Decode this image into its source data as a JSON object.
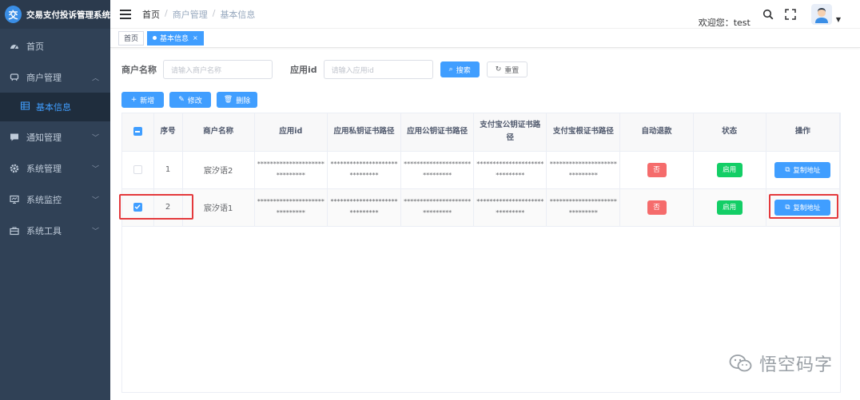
{
  "app": {
    "title": "交易支付投诉管理系统",
    "logo_char": "交"
  },
  "sidebar": {
    "items": [
      {
        "label": "首页",
        "icon": "dashboard-icon"
      },
      {
        "label": "商户管理",
        "icon": "shop-icon",
        "expanded": true
      },
      {
        "label": "通知管理",
        "icon": "message-icon"
      },
      {
        "label": "系统管理",
        "icon": "gear-icon"
      },
      {
        "label": "系统监控",
        "icon": "monitor-icon"
      },
      {
        "label": "系统工具",
        "icon": "toolbox-icon"
      }
    ],
    "sub_item": {
      "label": "基本信息",
      "icon": "table-icon"
    },
    "active_color": "#409eff",
    "bg_color": "#304156"
  },
  "header": {
    "breadcrumb": [
      "首页",
      "商户管理",
      "基本信息"
    ],
    "welcome": "欢迎您：test"
  },
  "tags": [
    {
      "label": "首页",
      "active": false
    },
    {
      "label": "基本信息",
      "active": true
    }
  ],
  "search": {
    "merchant_label": "商户名称",
    "merchant_placeholder": "请输入商户名称",
    "appid_label": "应用id",
    "appid_placeholder": "请输入应用id",
    "search_button": "搜索",
    "reset_button": "重置"
  },
  "toolbar": {
    "add": "新增",
    "edit": "修改",
    "delete": "删除"
  },
  "table": {
    "columns": [
      "序号",
      "商户名称",
      "应用id",
      "应用私钥证书路径",
      "应用公钥证书路径",
      "支付宝公钥证书路径",
      "支付宝根证书路径",
      "自动退款",
      "状态",
      "操作"
    ],
    "rows": [
      {
        "selected": false,
        "index": "1",
        "merchant": "宸汐语2",
        "appid": "******************************",
        "app_private": "******************************",
        "app_public": "******************************",
        "alipay_public": "******************************",
        "alipay_root": "******************************",
        "auto_refund": "否",
        "status": "启用",
        "action": "复制地址"
      },
      {
        "selected": true,
        "index": "2",
        "merchant": "宸汐语1",
        "appid": "******************************",
        "app_private": "******************************",
        "app_public": "******************************",
        "alipay_public": "******************************",
        "alipay_root": "******************************",
        "auto_refund": "否",
        "status": "启用",
        "action": "复制地址"
      }
    ]
  },
  "watermark": "悟空码字",
  "colors": {
    "primary": "#409eff",
    "danger": "#f56c6c",
    "success": "#13ce66",
    "highlight": "#e4393c"
  }
}
